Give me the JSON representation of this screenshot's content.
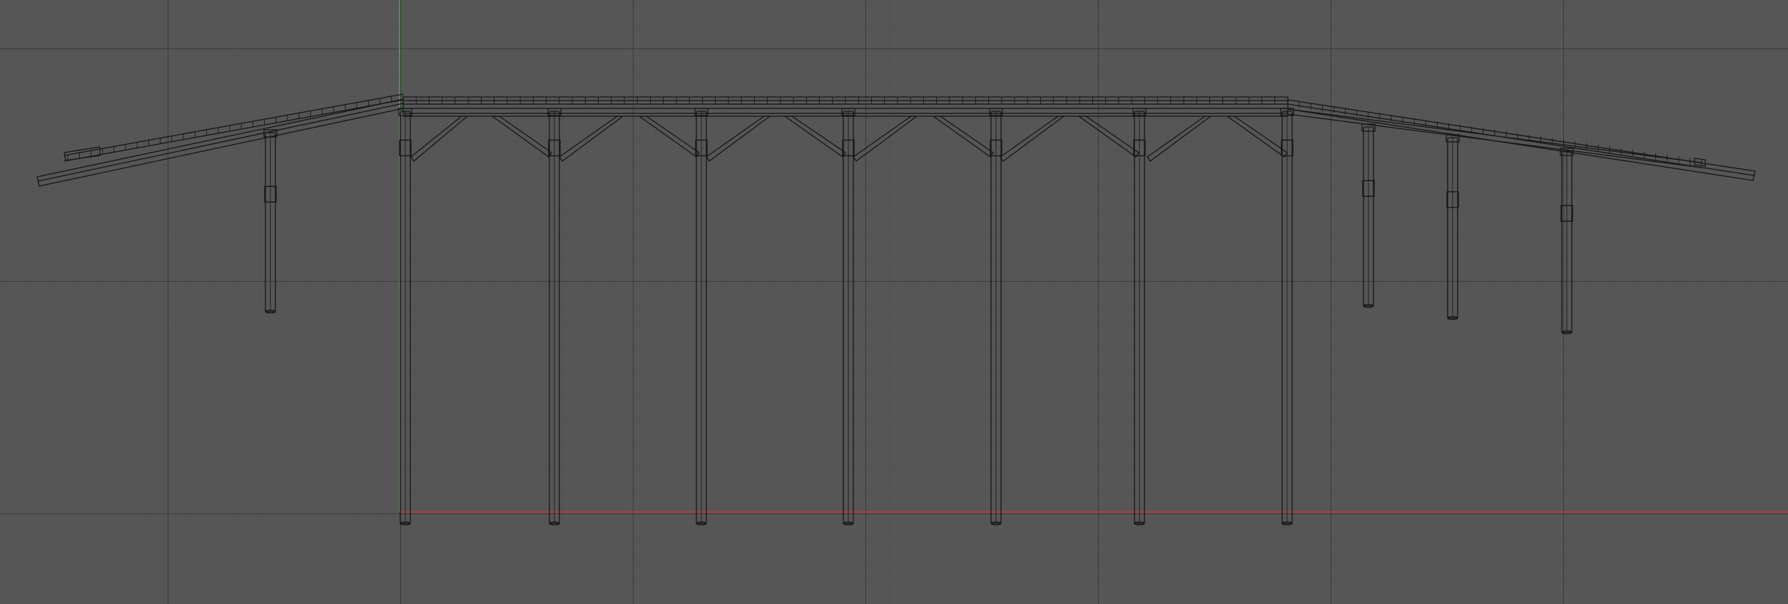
{
  "viewport": {
    "view": "orthographic-side",
    "shading": "wireframe",
    "grid": true
  },
  "colors": {
    "background": "#565656",
    "grid_major": "#3f3f3f",
    "grid_minor": "#4f4f4f",
    "x_axis": "#b33b3b",
    "z_axis": "#3f9a3f",
    "wire": "#151515"
  },
  "model": {
    "name": "",
    "post_count": 11,
    "brace_pairs": 6
  }
}
